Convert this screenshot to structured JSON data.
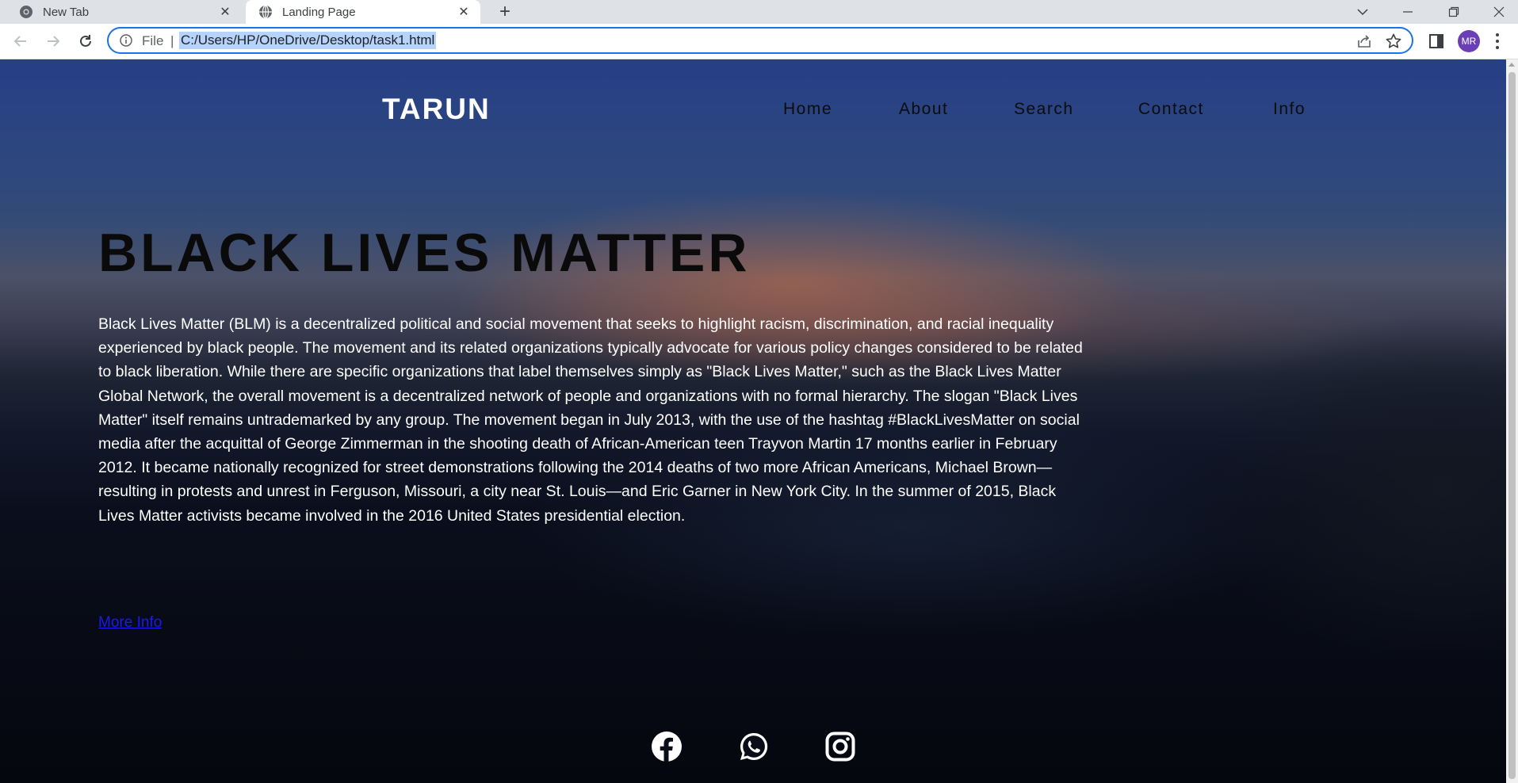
{
  "browser": {
    "tabs": [
      {
        "title": "New Tab",
        "active": false
      },
      {
        "title": "Landing Page",
        "active": true
      }
    ],
    "address": {
      "scheme_label": "File",
      "separator": "|",
      "url": "C:/Users/HP/OneDrive/Desktop/task1.html"
    },
    "profile_initials": "MR"
  },
  "site": {
    "brand": "TARUN",
    "nav": [
      "Home",
      "About",
      "Search",
      "Contact",
      "Info"
    ],
    "hero": {
      "title": "BLACK LIVES MATTER",
      "body": "Black Lives Matter (BLM) is a decentralized political and social movement that seeks to highlight racism, discrimination, and racial inequality experienced by black people. The movement and its related organizations typically advocate for various policy changes considered to be related to black liberation. While there are specific organizations that label themselves simply as \"Black Lives Matter,\" such as the Black Lives Matter Global Network, the overall movement is a decentralized network of people and organizations with no formal hierarchy. The slogan \"Black Lives Matter\" itself remains untrademarked by any group. The movement began in July 2013, with the use of the hashtag #BlackLivesMatter on social media after the acquittal of George Zimmerman in the shooting death of African-American teen Trayvon Martin 17 months earlier in February 2012. It became nationally recognized for street demonstrations following the 2014 deaths of two more African Americans, Michael Brown—resulting in protests and unrest in Ferguson, Missouri, a city near St. Louis—and Eric Garner in New York City. In the summer of 2015, Black Lives Matter activists became involved in the 2016 United States presidential election.",
      "more_link": "More Info"
    },
    "social_icons": [
      "facebook-icon",
      "whatsapp-icon",
      "instagram-icon"
    ]
  }
}
